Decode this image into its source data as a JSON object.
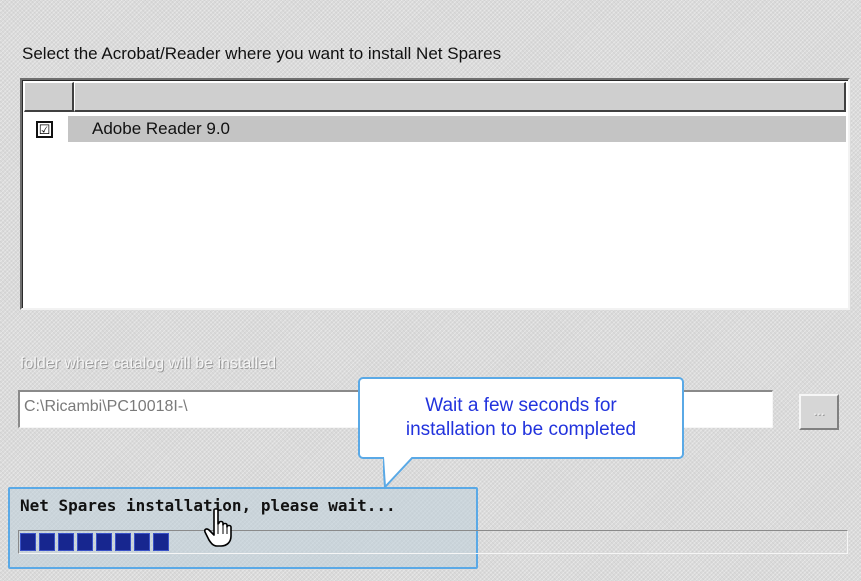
{
  "instruction": "Select the Acrobat/Reader where you want to install Net Spares",
  "reader_list": {
    "items": [
      {
        "label": "Adobe Reader 9.0",
        "checked": true,
        "check_glyph": "☑"
      }
    ]
  },
  "folder": {
    "label": "folder where catalog will be installed",
    "value": "C:\\Ricambi\\PC10018I-\\",
    "browse_label": "..."
  },
  "callout": {
    "line1": "Wait a few seconds for",
    "line2": "installation to be completed"
  },
  "progress": {
    "status": "Net Spares installation, please wait...",
    "fraction": 0.19
  },
  "colors": {
    "accent": "#5aa9e6",
    "callout_text": "#2233dd",
    "progress_fill": "#17268f"
  },
  "icons": {
    "cursor": "hand-pointer-icon",
    "checkbox": "checkbox-checked-icon"
  }
}
